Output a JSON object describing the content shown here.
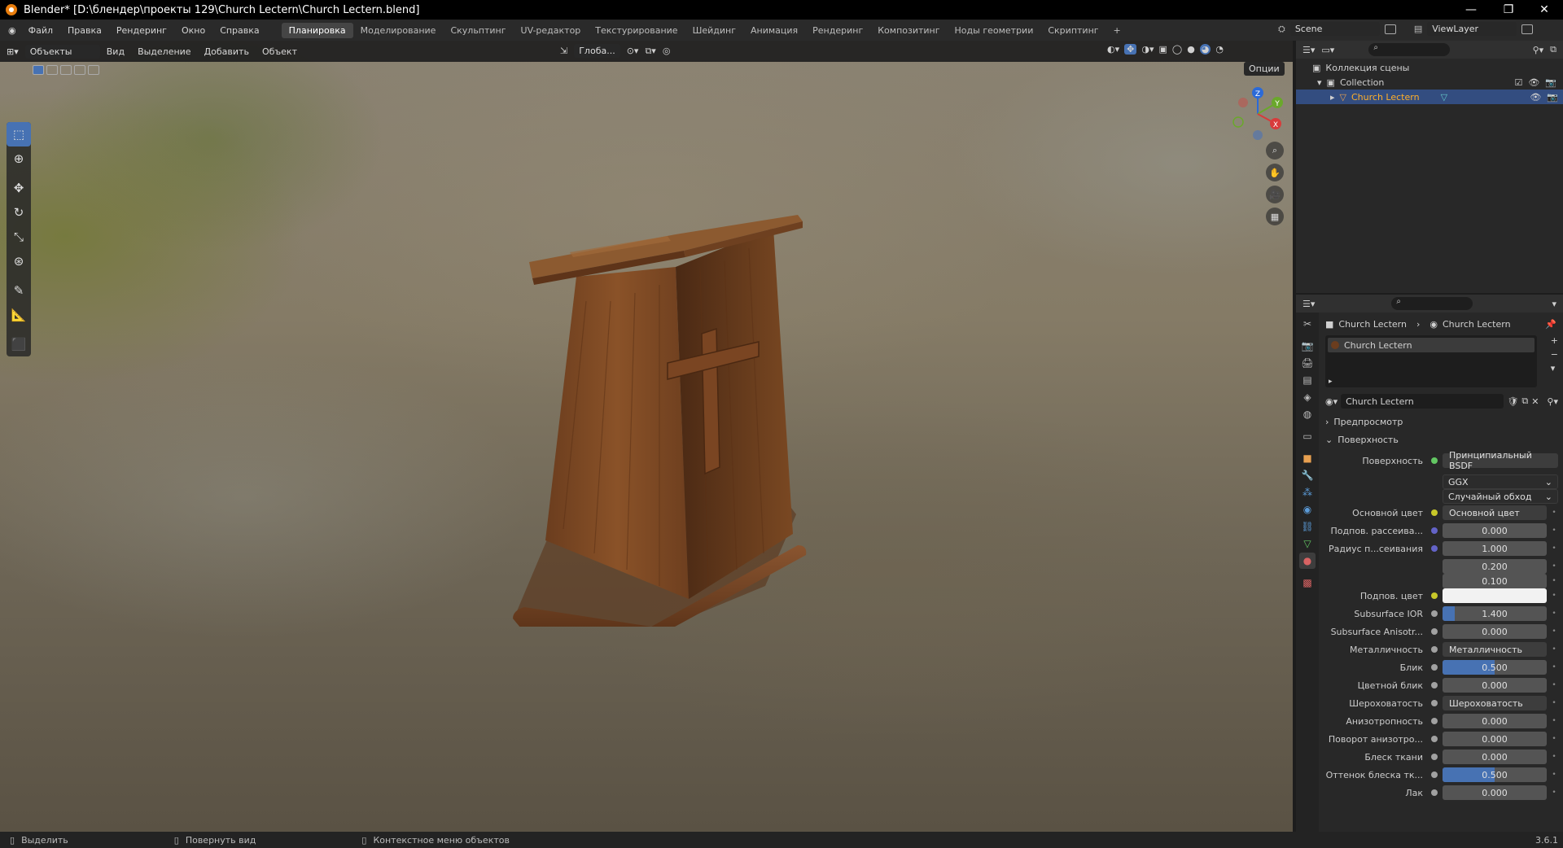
{
  "window": {
    "title": "Blender* [D:\\блендер\\проекты 129\\Church Lectern\\Church Lectern.blend]",
    "minimize": "—",
    "maximize": "❐",
    "close": "✕"
  },
  "menu": {
    "items": [
      "Файл",
      "Правка",
      "Рендеринг",
      "Окно",
      "Справка"
    ],
    "workspaces": [
      "Планировка",
      "Моделирование",
      "Скульптинг",
      "UV-редактор",
      "Текстурирование",
      "Шейдинг",
      "Анимация",
      "Рендеринг",
      "Композитинг",
      "Ноды геометрии",
      "Скриптинг"
    ],
    "active_workspace": 0,
    "add_tab": "+",
    "scene": "Scene",
    "viewlayer": "ViewLayer"
  },
  "viewport": {
    "mode": "Объекты",
    "menus": [
      "Вид",
      "Выделение",
      "Добавить",
      "Объект"
    ],
    "orientation": "Глоба...",
    "options": "Опции",
    "gizmo": {
      "x": "X",
      "y": "Y",
      "z": "Z"
    }
  },
  "outliner": {
    "scene_collection": "Коллекция сцены",
    "collection": "Collection",
    "object": "Church Lectern"
  },
  "properties": {
    "breadcrumb": [
      "Church Lectern",
      "Church Lectern"
    ],
    "slot": "Church Lectern",
    "material_name": "Church Lectern",
    "sections": {
      "preview": "Предпросмотр",
      "surface": "Поверхность"
    },
    "surface_label": "Поверхность",
    "surface_value": "Принципиальный BSDF",
    "distribution": "GGX",
    "subsurface_method": "Случайный обход",
    "rows": [
      {
        "label": "Основной цвет",
        "type": "link",
        "value": "Основной цвет",
        "dot": "#c7c729",
        "expand": true
      },
      {
        "label": "Подпов. рассеива...",
        "type": "num",
        "value": "0.000",
        "dot": "#6363c7",
        "fill": 0
      },
      {
        "label": "Радиус п...сеивания",
        "type": "num",
        "value": "1.000",
        "dot": "#6363c7",
        "fill": 0
      },
      {
        "label": "",
        "type": "num",
        "value": "0.200",
        "fill": 0
      },
      {
        "label": "",
        "type": "num",
        "value": "0.100",
        "fill": 0
      },
      {
        "label": "Подпов. цвет",
        "type": "color",
        "value": "",
        "dot": "#c7c729"
      },
      {
        "label": "Subsurface IOR",
        "type": "num",
        "value": "1.400",
        "dot": "#a1a1a1",
        "fill": 0.12
      },
      {
        "label": "Subsurface Anisotr...",
        "type": "num",
        "value": "0.000",
        "dot": "#a1a1a1",
        "fill": 0
      },
      {
        "label": "Металличность",
        "type": "link",
        "value": "Металличность",
        "dot": "#a1a1a1",
        "expand": true
      },
      {
        "label": "Блик",
        "type": "num",
        "value": "0.500",
        "dot": "#a1a1a1",
        "fill": 0.5
      },
      {
        "label": "Цветной блик",
        "type": "num",
        "value": "0.000",
        "dot": "#a1a1a1",
        "fill": 0
      },
      {
        "label": "Шероховатость",
        "type": "link",
        "value": "Шероховатость",
        "dot": "#a1a1a1",
        "expand": true
      },
      {
        "label": "Анизотропность",
        "type": "num",
        "value": "0.000",
        "dot": "#a1a1a1",
        "fill": 0
      },
      {
        "label": "Поворот анизотро...",
        "type": "num",
        "value": "0.000",
        "dot": "#a1a1a1",
        "fill": 0
      },
      {
        "label": "Блеск ткани",
        "type": "num",
        "value": "0.000",
        "dot": "#a1a1a1",
        "fill": 0
      },
      {
        "label": "Оттенок блеска тк...",
        "type": "num",
        "value": "0.500",
        "dot": "#a1a1a1",
        "fill": 0.5
      },
      {
        "label": "Лак",
        "type": "num",
        "value": "0.000",
        "dot": "#a1a1a1",
        "fill": 0
      }
    ]
  },
  "status": {
    "select": "Выделить",
    "rotate": "Повернуть вид",
    "context": "Контекстное меню объектов",
    "version": "3.6.1"
  }
}
